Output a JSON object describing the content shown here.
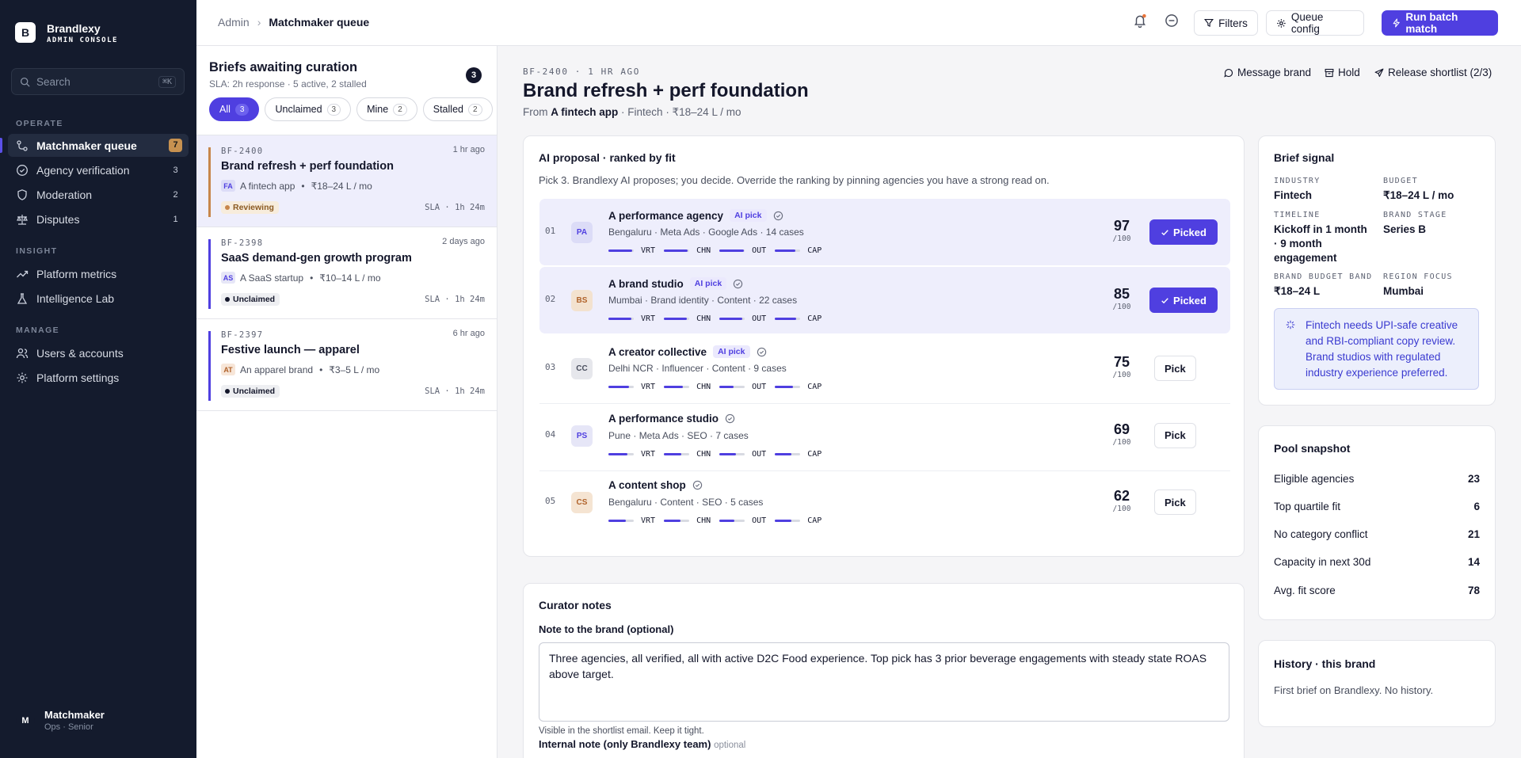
{
  "sidebar": {
    "brand_name": "Brandlexy",
    "brand_sub": "ADMIN CONSOLE",
    "logo_letter": "B",
    "search_placeholder": "Search",
    "search_shortcut": "⌘K",
    "sections": {
      "operate": "OPERATE",
      "insight": "INSIGHT",
      "manage": "MANAGE"
    },
    "operate_items": [
      {
        "label": "Matchmaker queue",
        "count": "7",
        "icon": "matchmaker-icon"
      },
      {
        "label": "Agency verification",
        "count": "3",
        "icon": "check-circle-icon"
      },
      {
        "label": "Moderation",
        "count": "2",
        "icon": "shield-icon"
      },
      {
        "label": "Disputes",
        "count": "1",
        "icon": "scale-icon"
      }
    ],
    "insight_items": [
      {
        "label": "Platform metrics",
        "icon": "trend-icon"
      },
      {
        "label": "Intelligence Lab",
        "icon": "flask-icon"
      }
    ],
    "manage_items": [
      {
        "label": "Users & accounts",
        "icon": "users-icon"
      },
      {
        "label": "Platform settings",
        "icon": "gear-icon"
      }
    ],
    "user": {
      "initial": "M",
      "name": "Matchmaker",
      "role": "Ops · Senior"
    }
  },
  "topbar": {
    "crumb_root": "Admin",
    "crumb_current": "Matchmaker queue",
    "filters": "Filters",
    "queue_config": "Queue config",
    "run_batch": "Run batch match"
  },
  "briefs": {
    "title": "Briefs awaiting curation",
    "sla": "SLA: 2h response · 5 active, 2 stalled",
    "count": "3",
    "filters": [
      {
        "label": "All",
        "count": "3"
      },
      {
        "label": "Unclaimed",
        "count": "3"
      },
      {
        "label": "Mine",
        "count": "2"
      },
      {
        "label": "Stalled",
        "count": "2"
      }
    ],
    "items": [
      {
        "id": "BF-2400",
        "ago": "1 hr ago",
        "title": "Brand refresh + perf foundation",
        "initials": "FA",
        "client": "A fintech app",
        "budget": "₹18–24 L / mo",
        "status": "Reviewing",
        "sla": "SLA · 1h 24m"
      },
      {
        "id": "BF-2398",
        "ago": "2 days ago",
        "title": "SaaS demand-gen growth program",
        "initials": "AS",
        "client": "A SaaS startup",
        "budget": "₹10–14 L / mo",
        "status": "Unclaimed",
        "sla": "SLA · 1h 24m"
      },
      {
        "id": "BF-2397",
        "ago": "6 hr ago",
        "title": "Festive launch — apparel",
        "initials": "AT",
        "client": "An apparel brand",
        "budget": "₹3–5 L / mo",
        "status": "Unclaimed",
        "sla": "SLA · 1h 24m"
      }
    ]
  },
  "detail": {
    "id_line": "BF-2400 · 1 HR AGO",
    "title": "Brand refresh + perf foundation",
    "from_prefix": "From",
    "from_client": "A fintech app",
    "from_rest": "· Fintech · ₹18–24 L / mo",
    "actions": {
      "message": "Message brand",
      "hold": "Hold",
      "release": "Release shortlist (2/3)"
    }
  },
  "ai": {
    "title": "AI proposal · ranked by fit",
    "subtitle": "Pick 3. Brandlexy AI proposes; you decide. Override the ranking by pinning agencies you have a strong read on.",
    "bar_labels": [
      "VRT",
      "CHN",
      "OUT",
      "CAP"
    ],
    "score_denominator": "/100",
    "ai_pick_label": "AI pick",
    "agencies": [
      {
        "rank": "01",
        "initials": "PA",
        "name": "A performance agency",
        "ai_pick": true,
        "sub": "Bengaluru · Meta Ads · Google Ads · 14 cases",
        "score": "97",
        "bars": [
          0.95,
          0.95,
          0.95,
          0.8
        ],
        "action": "Picked",
        "picked": true
      },
      {
        "rank": "02",
        "initials": "BS",
        "name": "A brand studio",
        "ai_pick": true,
        "sub": "Mumbai · Brand identity · Content · 22 cases",
        "score": "85",
        "bars": [
          0.9,
          0.9,
          0.9,
          0.85
        ],
        "action": "Picked",
        "picked": true
      },
      {
        "rank": "03",
        "initials": "CC",
        "name": "A creator collective",
        "ai_pick": true,
        "sub": "Delhi NCR · Influencer · Content · 9 cases",
        "score": "75",
        "bars": [
          0.8,
          0.75,
          0.55,
          0.7
        ],
        "action": "Pick",
        "picked": false
      },
      {
        "rank": "04",
        "initials": "PS",
        "name": "A performance studio",
        "ai_pick": false,
        "sub": "Pune · Meta Ads · SEO · 7 cases",
        "score": "69",
        "bars": [
          0.75,
          0.7,
          0.65,
          0.65
        ],
        "action": "Pick",
        "picked": false
      },
      {
        "rank": "05",
        "initials": "CS",
        "name": "A content shop",
        "ai_pick": false,
        "sub": "Bengaluru · Content · SEO · 5 cases",
        "score": "62",
        "bars": [
          0.7,
          0.65,
          0.6,
          0.65
        ],
        "action": "Pick",
        "picked": false
      }
    ]
  },
  "signal": {
    "title": "Brief signal",
    "fields": [
      {
        "k": "INDUSTRY",
        "v": "Fintech"
      },
      {
        "k": "BUDGET",
        "v": "₹18–24 L / mo"
      },
      {
        "k": "TIMELINE",
        "v": "Kickoff in 1 month · 9 month engagement"
      },
      {
        "k": "BRAND STAGE",
        "v": "Series B"
      },
      {
        "k": "BRAND BUDGET BAND",
        "v": "₹18–24 L"
      },
      {
        "k": "REGION FOCUS",
        "v": "Mumbai"
      }
    ],
    "note": "Fintech needs UPI-safe creative and RBI-compliant copy review. Brand studios with regulated industry experience preferred."
  },
  "pool": {
    "title": "Pool snapshot",
    "rows": [
      {
        "k": "Eligible agencies",
        "v": "23"
      },
      {
        "k": "Top quartile fit",
        "v": "6"
      },
      {
        "k": "No category conflict",
        "v": "21"
      },
      {
        "k": "Capacity in next 30d",
        "v": "14"
      },
      {
        "k": "Avg. fit score",
        "v": "78"
      }
    ]
  },
  "history": {
    "title": "History · this brand",
    "text": "First brief on Brandlexy. No history."
  },
  "notes": {
    "title": "Curator notes",
    "brand_label": "Note to the brand (optional)",
    "brand_value": "Three agencies, all verified, all with active D2C Food experience. Top pick has 3 prior beverage engagements with steady state ROAS above target.",
    "hint": "Visible in the shortlist email. Keep it tight.",
    "internal_label": "Internal note (only Brandlexy team)",
    "internal_optional": "optional"
  },
  "colors": {
    "accent": "#4f3fe0",
    "sidebar": "#141b2d",
    "selected_brief_bar": "#c7864b"
  }
}
